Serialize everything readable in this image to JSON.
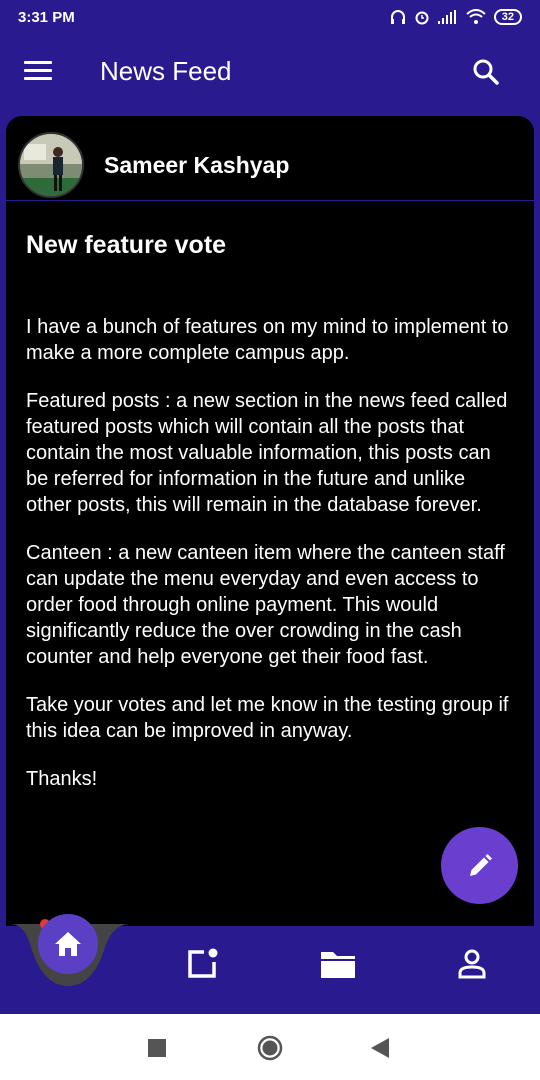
{
  "status_bar": {
    "time": "3:31 PM",
    "battery": "32"
  },
  "app_bar": {
    "title": "News Feed"
  },
  "post": {
    "author": "Sameer Kashyap",
    "title": "New feature vote",
    "paragraphs": [
      "I have a bunch of features on my mind to implement to make a more complete campus app.",
      "Featured posts : a new section in the news feed called featured posts which will contain all the posts that contain the most valuable information, this posts can be referred for information in the future and unlike other posts, this will remain in the database forever.",
      "Canteen : a new canteen item where the canteen staff can update the menu everyday and even access to order food through online payment. This would significantly reduce the over crowding in the cash counter and help everyone get their food fast.",
      "Take your votes and let me know in the testing group if this idea can be improved in anyway.",
      "Thanks!"
    ]
  },
  "colors": {
    "primary": "#2a1a8f",
    "accent": "#6a3fd0",
    "card": "#000000",
    "badge": "#e53935"
  },
  "icons": {
    "menu": "menu-icon",
    "search": "search-icon",
    "edit": "pencil-icon",
    "home": "home-icon",
    "new_post": "new-post-icon",
    "folder": "folder-icon",
    "profile": "person-icon"
  }
}
